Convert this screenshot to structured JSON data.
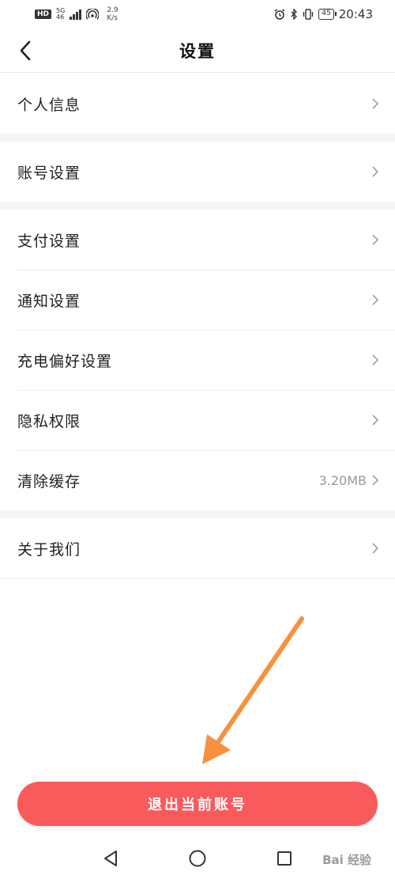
{
  "status_bar": {
    "hd_badge": "HD",
    "net_type": "5G",
    "net_sub": "46",
    "speed_value": "2.9",
    "speed_unit": "K/s",
    "battery": "45",
    "time": "20:43"
  },
  "header": {
    "title": "设置"
  },
  "menu_groups": [
    [
      {
        "label": "个人信息",
        "value": ""
      }
    ],
    [
      {
        "label": "账号设置",
        "value": ""
      }
    ],
    [
      {
        "label": "支付设置",
        "value": ""
      },
      {
        "label": "通知设置",
        "value": ""
      },
      {
        "label": "充电偏好设置",
        "value": ""
      },
      {
        "label": "隐私权限",
        "value": ""
      },
      {
        "label": "清除缓存",
        "value": "3.20MB"
      }
    ],
    [
      {
        "label": "关于我们",
        "value": ""
      }
    ]
  ],
  "logout_label": "退出当前账号",
  "watermark": "Bai 经验",
  "colors": {
    "accent": "#f95a5c",
    "arrow": "#f7913d",
    "separator": "#f5f5f5"
  }
}
